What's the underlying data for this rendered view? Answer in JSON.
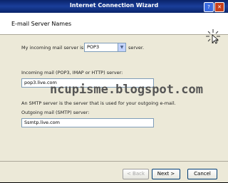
{
  "window": {
    "title": "Internet Connection Wizard"
  },
  "header": {
    "title": "E-mail Server Names",
    "icon": "cursor-sparkle-icon"
  },
  "form": {
    "server_type_label_before": "My incoming mail server is a",
    "server_type_value": "POP3",
    "server_type_label_after": "server.",
    "incoming_label": "Incoming mail (POP3, IMAP or HTTP) server:",
    "incoming_value": "pop3.live.com",
    "smtp_note": "An SMTP server is the server that is used for your outgoing e-mail.",
    "outgoing_label": "Outgoing mail (SMTP) server:",
    "outgoing_value": "Ssmtp.live.com"
  },
  "watermark": "ncupisme.blogspot.com",
  "buttons": {
    "back": "< Back",
    "next": "Next >",
    "cancel": "Cancel"
  }
}
